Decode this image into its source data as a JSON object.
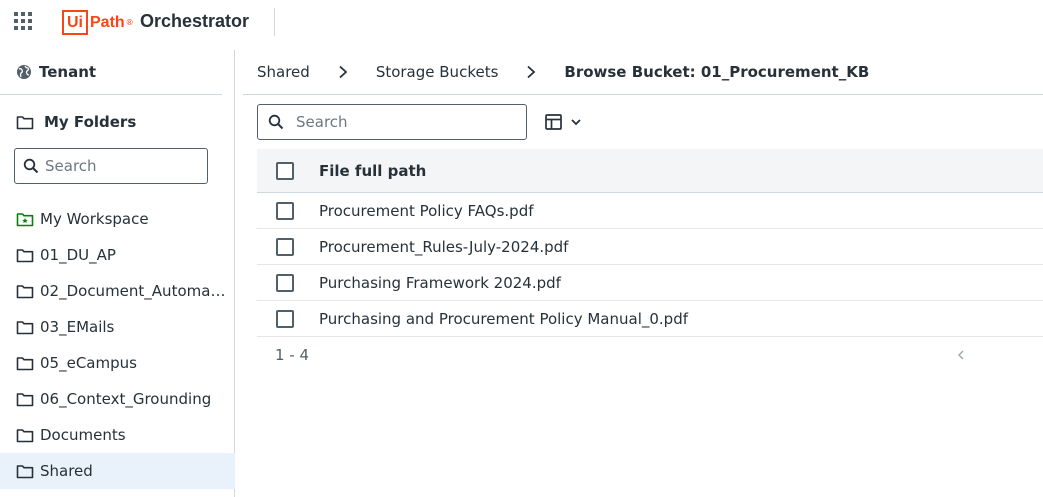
{
  "header": {
    "logo_ui": "Ui",
    "logo_path": "Path",
    "product": "Orchestrator"
  },
  "sidebar": {
    "tenant_label": "Tenant",
    "my_folders_label": "My Folders",
    "search_placeholder": "Search",
    "folders": [
      {
        "label": "My Workspace",
        "icon": "workspace-folder-icon"
      },
      {
        "label": "01_DU_AP",
        "icon": "folder-icon"
      },
      {
        "label": "02_Document_Automation",
        "icon": "folder-icon"
      },
      {
        "label": "03_EMails",
        "icon": "folder-icon"
      },
      {
        "label": "05_eCampus",
        "icon": "folder-icon"
      },
      {
        "label": "06_Context_Grounding",
        "icon": "folder-icon"
      },
      {
        "label": "Documents",
        "icon": "folder-icon"
      },
      {
        "label": "Shared",
        "icon": "folder-icon",
        "selected": true
      }
    ]
  },
  "breadcrumb": [
    "Shared",
    "Storage Buckets",
    "Browse Bucket: 01_Procurement_KB"
  ],
  "main": {
    "search_placeholder": "Search",
    "table": {
      "column_header": "File full path",
      "rows": [
        "Procurement Policy FAQs.pdf",
        "Procurement_Rules-July-2024.pdf",
        "Purchasing Framework 2024.pdf",
        "Purchasing and Procurement Policy Manual_0.pdf"
      ],
      "range_label": "1 - 4"
    }
  },
  "colors": {
    "brand": "#fa4616",
    "selected_bg": "#e9f1fa",
    "workspace_green": "#038108"
  }
}
